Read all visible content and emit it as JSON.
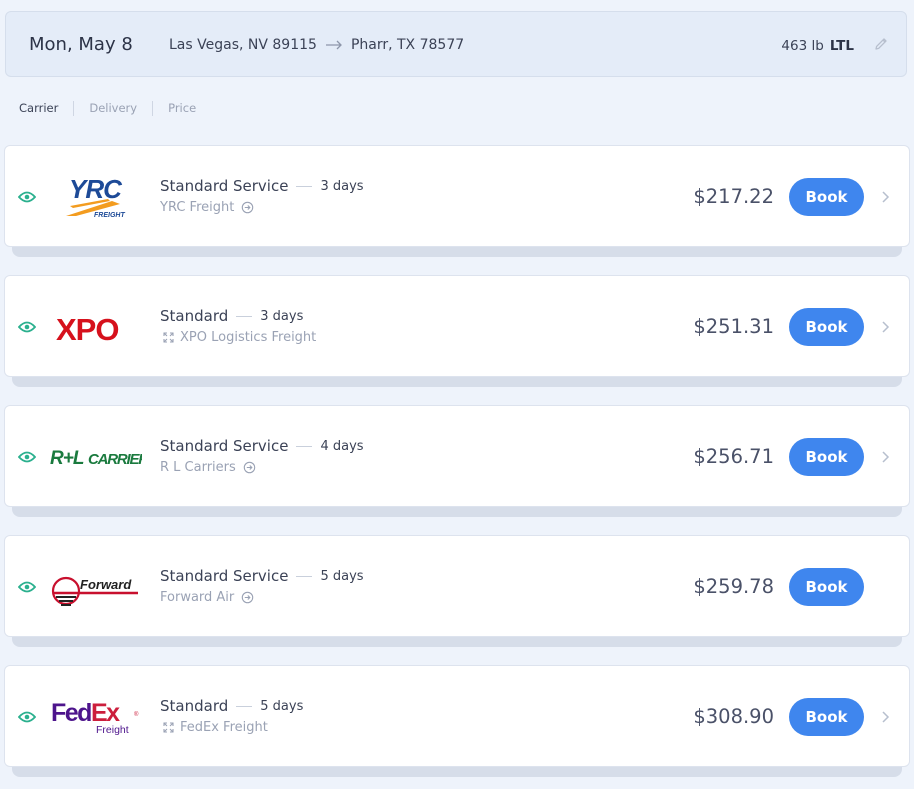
{
  "header": {
    "date": "Mon, May 8",
    "origin": "Las Vegas, NV 89115",
    "destination": "Pharr, TX 78577",
    "weight": "463 lb",
    "mode": "LTL"
  },
  "sort": {
    "carrier": "Carrier",
    "delivery": "Delivery",
    "price": "Price"
  },
  "quotes": [
    {
      "service": "Standard Service",
      "days": "3 days",
      "carrier": "YRC Freight",
      "carrier_icon": "arrow-circle-icon",
      "price": "$217.22",
      "book": "Book",
      "logo": "YRC FREIGHT",
      "has_chevron": true
    },
    {
      "service": "Standard",
      "days": "3 days",
      "carrier": "XPO Logistics Freight",
      "carrier_icon": "expand-icon",
      "price": "$251.31",
      "book": "Book",
      "logo": "XPO",
      "has_chevron": true
    },
    {
      "service": "Standard Service",
      "days": "4 days",
      "carrier": "R L Carriers",
      "carrier_icon": "arrow-circle-icon",
      "price": "$256.71",
      "book": "Book",
      "logo": "R+L CARRIERS",
      "has_chevron": true
    },
    {
      "service": "Standard Service",
      "days": "5 days",
      "carrier": "Forward Air",
      "carrier_icon": "arrow-circle-icon",
      "price": "$259.78",
      "book": "Book",
      "logo": "Forward",
      "has_chevron": false
    },
    {
      "service": "Standard",
      "days": "5 days",
      "carrier": "FedEx Freight",
      "carrier_icon": "expand-icon",
      "price": "$308.90",
      "book": "Book",
      "logo": "FedEx Freight",
      "has_chevron": true
    }
  ],
  "colors": {
    "accent": "#3f86ee",
    "eye": "#2bb08e",
    "background": "#eef3fb"
  }
}
